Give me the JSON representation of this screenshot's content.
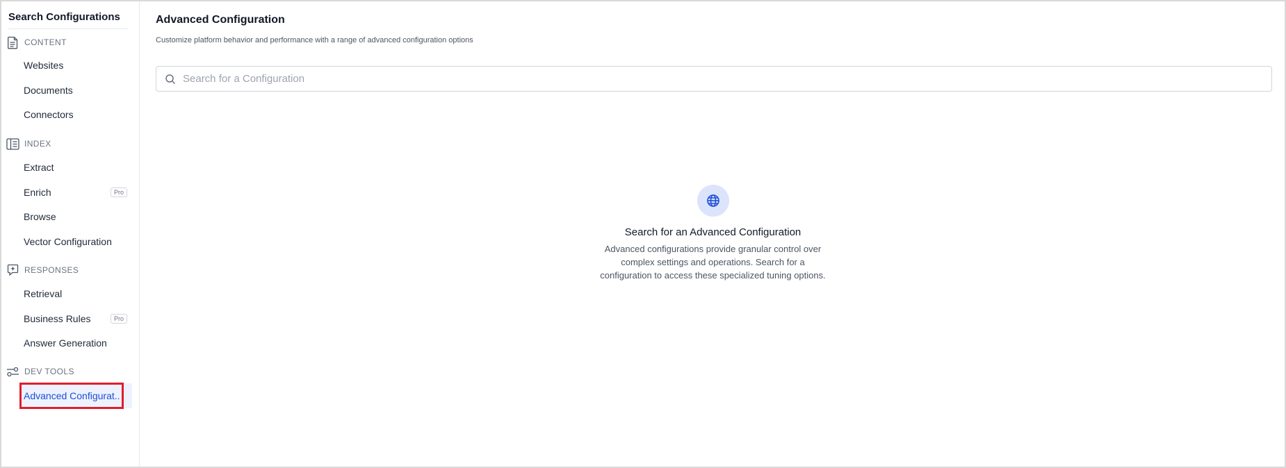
{
  "sidebar": {
    "title": "Search Configurations",
    "sections": [
      {
        "label": "CONTENT",
        "icon": "document-icon",
        "items": [
          {
            "label": "Websites"
          },
          {
            "label": "Documents"
          },
          {
            "label": "Connectors"
          }
        ]
      },
      {
        "label": "INDEX",
        "icon": "index-icon",
        "items": [
          {
            "label": "Extract"
          },
          {
            "label": "Enrich",
            "badge": "Pro"
          },
          {
            "label": "Browse"
          },
          {
            "label": "Vector Configuration"
          }
        ]
      },
      {
        "label": "RESPONSES",
        "icon": "response-icon",
        "items": [
          {
            "label": "Retrieval"
          },
          {
            "label": "Business Rules",
            "badge": "Pro"
          },
          {
            "label": "Answer Generation"
          }
        ]
      },
      {
        "label": "DEV TOOLS",
        "icon": "dev-tools-icon",
        "items": [
          {
            "label": "Advanced Configurat..",
            "active": true
          }
        ]
      }
    ]
  },
  "main": {
    "title": "Advanced Configuration",
    "subtitle": "Customize platform behavior and performance with a range of advanced configuration options",
    "search": {
      "placeholder": "Search for a Configuration",
      "value": ""
    },
    "empty_state": {
      "icon": "globe-icon",
      "title": "Search for an Advanced Configuration",
      "description": "Advanced configurations provide granular control over complex settings and operations. Search for a configuration to access these specialized tuning options."
    }
  },
  "colors": {
    "accent": "#1d4ed8",
    "highlight": "#e11d2b",
    "globe_bg": "#dbe4fb"
  }
}
